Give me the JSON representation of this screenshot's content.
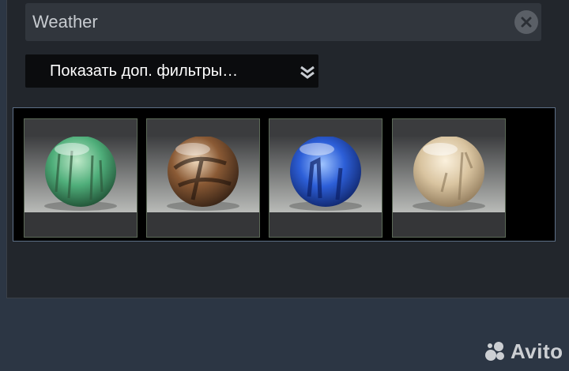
{
  "search": {
    "value": "Weather",
    "clear_icon": "close-icon"
  },
  "filters": {
    "toggle_label": "Показать доп. фильтры…",
    "toggle_icon": "double-chevron-down-icon"
  },
  "results": {
    "items": [
      {
        "name": "green orb",
        "tint": "#4fae7a"
      },
      {
        "name": "brown orb",
        "tint": "#8a5a35"
      },
      {
        "name": "blue orb",
        "tint": "#2d5fd8"
      },
      {
        "name": "beige orb",
        "tint": "#d9c4a0"
      }
    ]
  },
  "watermark": {
    "text": "Avito"
  }
}
